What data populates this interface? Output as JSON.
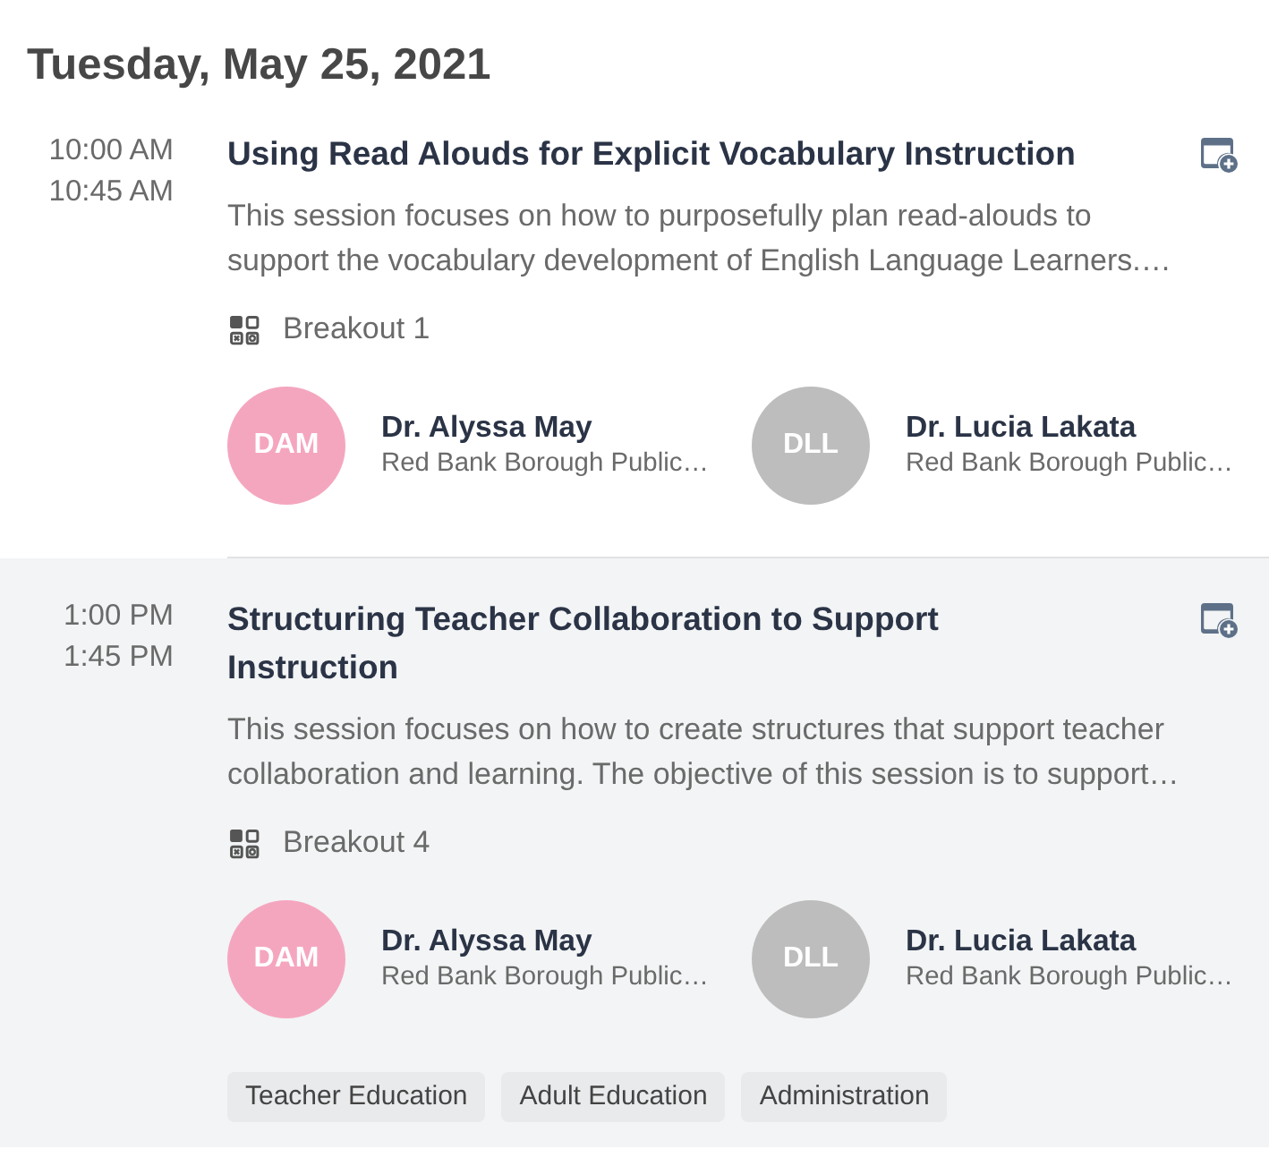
{
  "date_heading": "Tuesday, May 25, 2021",
  "sessions": [
    {
      "start": "10:00 AM",
      "end": "10:45 AM",
      "highlighted": false,
      "title": "Using Read Alouds for Explicit Vocabulary Instruction",
      "description": "This session focuses on how to purposefully plan read-alouds to support the vocabulary development of English Language Learners.…",
      "room": "Breakout 1",
      "speakers": [
        {
          "initials": "DAM",
          "name": "Dr. Alyssa May",
          "organization": "Red Bank Borough Public…",
          "color": "#f5a6bf"
        },
        {
          "initials": "DLL",
          "name": "Dr. Lucia Lakata",
          "organization": "Red Bank Borough Public…",
          "color": "#bdbdbd"
        }
      ]
    },
    {
      "start": "1:00 PM",
      "end": "1:45 PM",
      "highlighted": true,
      "title": "Structuring Teacher Collaboration to Support Instruction",
      "description": "This session focuses on how to create structures that support teacher collaboration and learning. The objective of this session is to support…",
      "room": "Breakout 4",
      "speakers": [
        {
          "initials": "DAM",
          "name": "Dr. Alyssa May",
          "organization": "Red Bank Borough Public…",
          "color": "#f5a6bf"
        },
        {
          "initials": "DLL",
          "name": "Dr. Lucia Lakata",
          "organization": "Red Bank Borough Public…",
          "color": "#bdbdbd"
        }
      ],
      "tags": [
        "Teacher Education",
        "Adult Education",
        "Administration"
      ]
    }
  ]
}
